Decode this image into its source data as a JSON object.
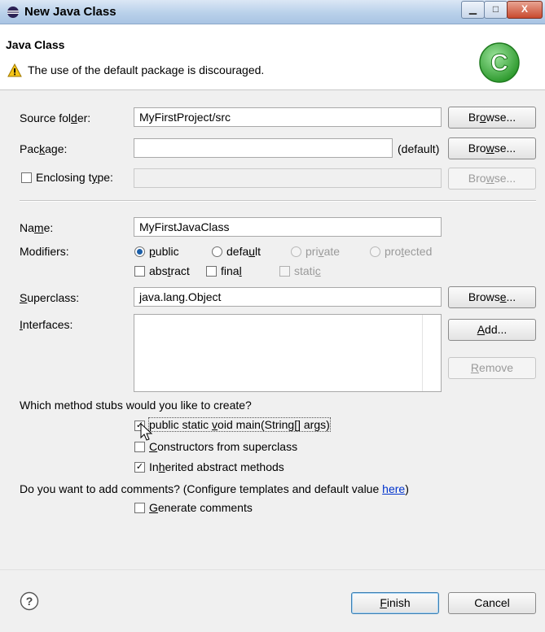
{
  "window": {
    "title": "New Java Class",
    "minimize": "▁",
    "maximize": "□",
    "close": "X"
  },
  "header": {
    "title": "Java Class",
    "message": "The use of the default package is discouraged."
  },
  "source_folder": {
    "label_pre": "Source fol",
    "label_ul": "d",
    "label_post": "er:",
    "value": "MyFirstProject/src",
    "browse_pre": "Br",
    "browse_ul": "o",
    "browse_post": "wse..."
  },
  "package": {
    "label_pre": "Pac",
    "label_ul": "k",
    "label_post": "age:",
    "value": "",
    "default_text": "(default)",
    "browse_pre": "Bro",
    "browse_ul": "w",
    "browse_post": "se..."
  },
  "enclosing": {
    "label_pre": "Enclosing t",
    "label_ul": "y",
    "label_post": "pe:",
    "value": "",
    "browse_pre": "Bro",
    "browse_ul": "w",
    "browse_post": "se..."
  },
  "name": {
    "label_pre": "Na",
    "label_ul": "m",
    "label_post": "e:",
    "value": "MyFirstJavaClass"
  },
  "modifiers": {
    "label": "Modifiers:",
    "public": {
      "pre": "",
      "ul": "p",
      "post": "ublic"
    },
    "default": {
      "pre": "defa",
      "ul": "u",
      "post": "lt"
    },
    "private": {
      "pre": "pri",
      "ul": "v",
      "post": "ate"
    },
    "protected": {
      "pre": "pro",
      "ul": "t",
      "post": "ected"
    },
    "abstract": {
      "pre": "abs",
      "ul": "t",
      "post": "ract"
    },
    "final": {
      "pre": "fina",
      "ul": "l",
      "post": ""
    },
    "static": {
      "pre": "stati",
      "ul": "c",
      "post": ""
    }
  },
  "superclass": {
    "label_ul": "S",
    "label_post": "uperclass:",
    "value": "java.lang.Object",
    "browse_pre": "Brows",
    "browse_ul": "e",
    "browse_post": "..."
  },
  "interfaces": {
    "label_ul": "I",
    "label_post": "nterfaces:",
    "add_ul": "A",
    "add_post": "dd...",
    "remove_ul": "R",
    "remove_post": "emove"
  },
  "stubs": {
    "question": "Which method stubs would you like to create?",
    "main": {
      "pre": "public static ",
      "ul": "v",
      "post": "oid main(String[] args)"
    },
    "constructors": {
      "ul": "C",
      "post": "onstructors from superclass"
    },
    "inherited": {
      "pre": "In",
      "ul": "h",
      "post": "erited abstract methods"
    }
  },
  "comments": {
    "question": "Do you want to add comments? (Configure templates and default value ",
    "link": "here",
    "question_end": ")",
    "generate_ul": "G",
    "generate_post": "enerate comments"
  },
  "footer": {
    "help": "?",
    "finish_ul": "F",
    "finish_post": "inish",
    "cancel": "Cancel"
  },
  "colors": {
    "accent": "#1a5ea8",
    "link": "#0033cc",
    "logo": "#3eb33e"
  }
}
